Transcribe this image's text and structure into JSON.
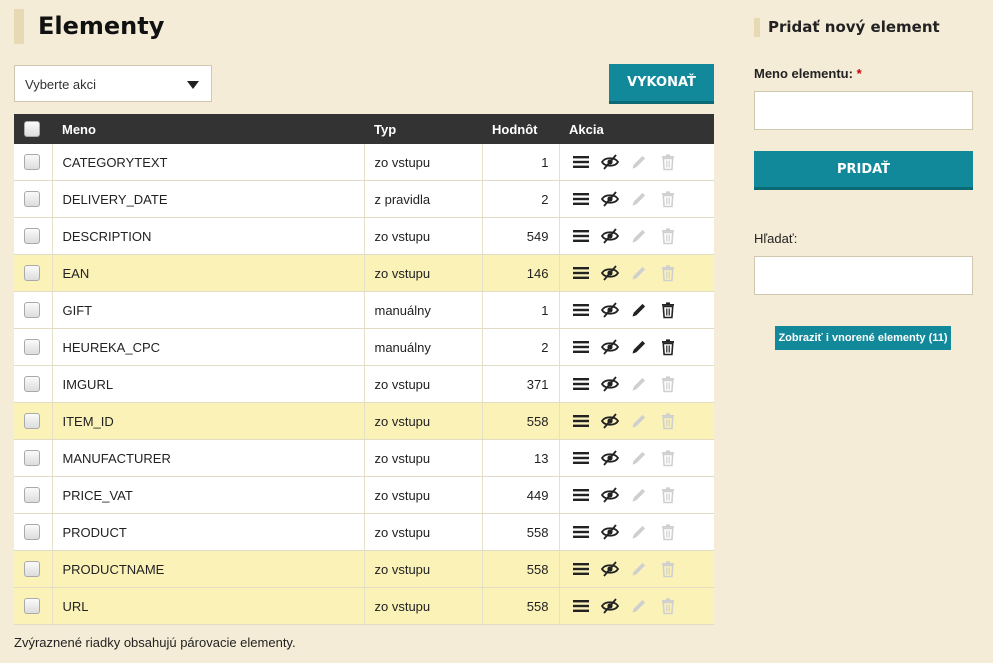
{
  "page_title": "Elementy",
  "bulk_action": {
    "selected": "Vyberte akci",
    "execute_label": "VYKONAŤ"
  },
  "table": {
    "columns": {
      "name": "Meno",
      "type": "Typ",
      "value": "Hodnôt",
      "actions": "Akcia"
    },
    "rows": [
      {
        "name": "CATEGORYTEXT",
        "type": "zo vstupu",
        "value": "1",
        "highlighted": false,
        "editable": false
      },
      {
        "name": "DELIVERY_DATE",
        "type": "z pravidla",
        "value": "2",
        "highlighted": false,
        "editable": false
      },
      {
        "name": "DESCRIPTION",
        "type": "zo vstupu",
        "value": "549",
        "highlighted": false,
        "editable": false
      },
      {
        "name": "EAN",
        "type": "zo vstupu",
        "value": "146",
        "highlighted": true,
        "editable": false
      },
      {
        "name": "GIFT",
        "type": "manuálny",
        "value": "1",
        "highlighted": false,
        "editable": true
      },
      {
        "name": "HEUREKA_CPC",
        "type": "manuálny",
        "value": "2",
        "highlighted": false,
        "editable": true
      },
      {
        "name": "IMGURL",
        "type": "zo vstupu",
        "value": "371",
        "highlighted": false,
        "editable": false
      },
      {
        "name": "ITEM_ID",
        "type": "zo vstupu",
        "value": "558",
        "highlighted": true,
        "editable": false
      },
      {
        "name": "MANUFACTURER",
        "type": "zo vstupu",
        "value": "13",
        "highlighted": false,
        "editable": false
      },
      {
        "name": "PRICE_VAT",
        "type": "zo vstupu",
        "value": "449",
        "highlighted": false,
        "editable": false
      },
      {
        "name": "PRODUCT",
        "type": "zo vstupu",
        "value": "558",
        "highlighted": false,
        "editable": false
      },
      {
        "name": "PRODUCTNAME",
        "type": "zo vstupu",
        "value": "558",
        "highlighted": true,
        "editable": false
      },
      {
        "name": "URL",
        "type": "zo vstupu",
        "value": "558",
        "highlighted": true,
        "editable": false
      }
    ]
  },
  "footnote": "Zvýraznené riadky obsahujú párovacie elementy.",
  "sidebar": {
    "title": "Pridať nový element",
    "name_label": "Meno elementu:",
    "required_mark": "*",
    "name_value": "",
    "add_label": "PRIDAŤ",
    "search_label": "Hľadať:",
    "search_value": "",
    "nested_button": "Zobraziť i vnorené elementy (11)"
  },
  "icons": {
    "list": "list-icon",
    "visibility": "eye-slash-icon",
    "edit": "pencil-icon",
    "delete": "trash-icon"
  },
  "colors": {
    "accent": "#12899a",
    "header_bg": "#333333",
    "highlight": "#fbf2b8",
    "page_bg": "#f5ecd7",
    "disabled_icon": "#cfcfcf"
  }
}
